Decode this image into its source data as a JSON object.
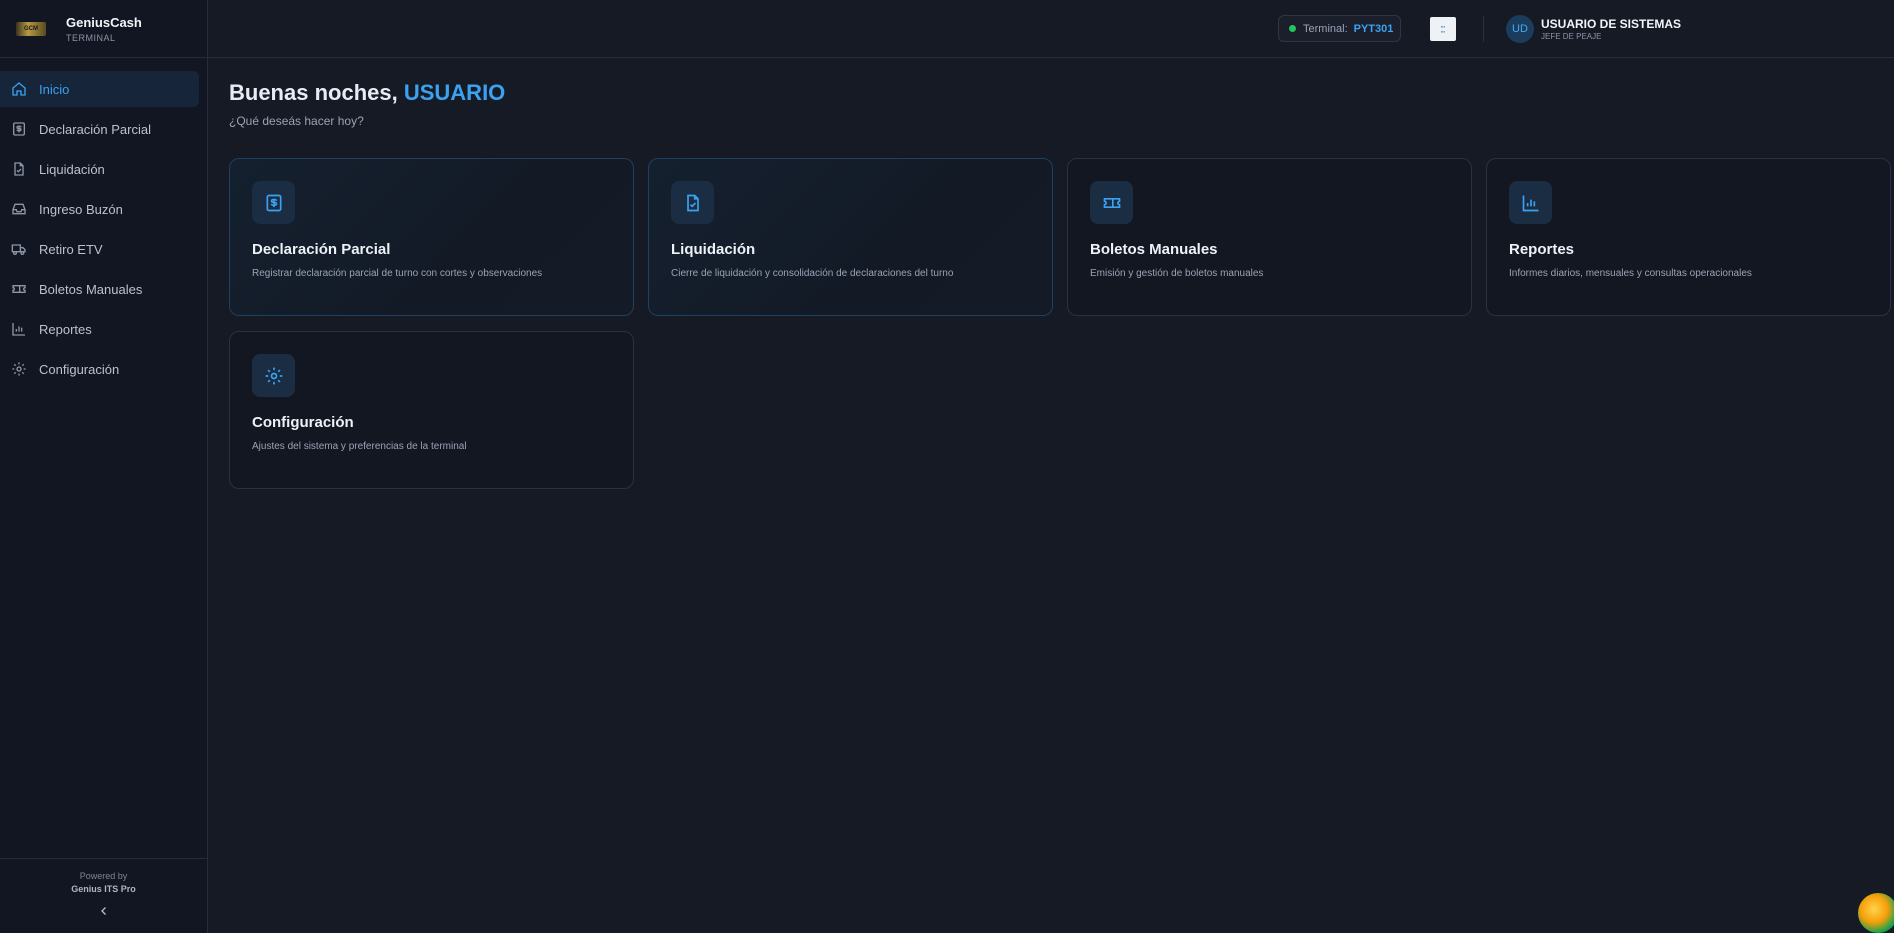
{
  "brand": {
    "name": "GeniusCash",
    "subtitle": "TERMINAL",
    "logo_text": "GCM"
  },
  "sidebar": {
    "items": [
      {
        "label": "Inicio",
        "icon": "home-icon",
        "active": true
      },
      {
        "label": "Declaración Parcial",
        "icon": "dollar-doc-icon"
      },
      {
        "label": "Liquidación",
        "icon": "file-check-icon"
      },
      {
        "label": "Ingreso Buzón",
        "icon": "inbox-icon"
      },
      {
        "label": "Retiro ETV",
        "icon": "truck-icon"
      },
      {
        "label": "Boletos Manuales",
        "icon": "ticket-icon"
      },
      {
        "label": "Reportes",
        "icon": "bar-chart-icon"
      },
      {
        "label": "Configuración",
        "icon": "gear-icon"
      }
    ],
    "footer": {
      "powered_by": "Powered by",
      "product": "Genius ITS Pro"
    }
  },
  "header": {
    "terminal_label": "Terminal:",
    "terminal_code": "PYT301",
    "terminal_status_color": "#22c55e",
    "user_initials": "UD",
    "user_name": "USUARIO DE SISTEMAS",
    "user_role": "JEFE DE PEAJE"
  },
  "main": {
    "greeting": "Buenas noches,",
    "greeting_name": "USUARIO",
    "subtitle": "¿Qué deseás hacer hoy?",
    "cards": [
      {
        "title": "Declaración Parcial",
        "desc": "Registrar declaración parcial de turno con cortes y observaciones",
        "icon": "dollar-doc-icon"
      },
      {
        "title": "Liquidación",
        "desc": "Cierre de liquidación y consolidación de declaraciones del turno",
        "icon": "file-check-icon"
      },
      {
        "title": "Boletos Manuales",
        "desc": "Emisión y gestión de boletos manuales",
        "icon": "ticket-icon"
      },
      {
        "title": "Reportes",
        "desc": "Informes diarios, mensuales y consultas operacionales",
        "icon": "bar-chart-icon"
      },
      {
        "title": "Configuración",
        "desc": "Ajustes del sistema y preferencias de la terminal",
        "icon": "gear-icon"
      }
    ]
  },
  "colors": {
    "accent": "#3aa2f0",
    "background": "#161a24",
    "sidebar": "#121622"
  }
}
